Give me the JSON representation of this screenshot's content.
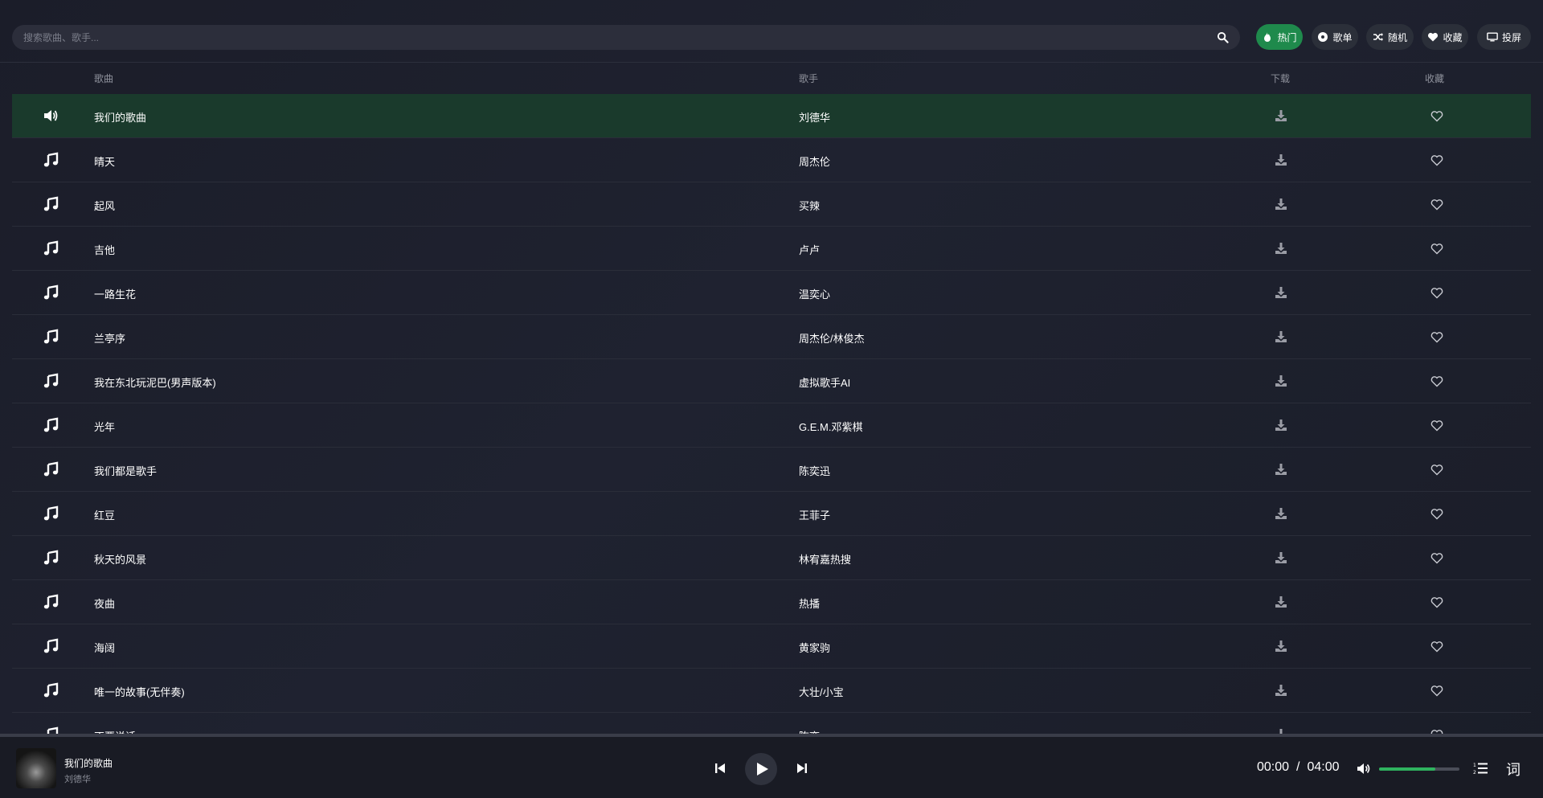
{
  "search": {
    "placeholder": "搜索歌曲、歌手..."
  },
  "nav": [
    {
      "label": "热门",
      "icon": "fire-icon",
      "active": true
    },
    {
      "label": "歌单",
      "icon": "disc-icon",
      "active": false
    },
    {
      "label": "随机",
      "icon": "shuffle-icon",
      "active": false
    },
    {
      "label": "收藏",
      "icon": "heart-icon",
      "active": false
    },
    {
      "label": "投屏",
      "icon": "tv-icon",
      "active": false
    }
  ],
  "table": {
    "headers": {
      "title": "歌曲",
      "artist": "歌手",
      "download": "下载",
      "favorite": "收藏"
    },
    "rows": [
      {
        "title": "我们的歌曲",
        "artist": "刘德华",
        "playing": true
      },
      {
        "title": "晴天",
        "artist": "周杰伦"
      },
      {
        "title": "起风",
        "artist": "买辣"
      },
      {
        "title": "吉他",
        "artist": "卢卢"
      },
      {
        "title": "一路生花",
        "artist": "温奕心"
      },
      {
        "title": "兰亭序",
        "artist": "周杰伦/林俊杰"
      },
      {
        "title": "我在东北玩泥巴(男声版本)",
        "artist": "虚拟歌手AI"
      },
      {
        "title": "光年",
        "artist": "G.E.M.邓紫棋"
      },
      {
        "title": "我们都是歌手",
        "artist": "陈奕迅"
      },
      {
        "title": "红豆",
        "artist": "王菲子"
      },
      {
        "title": "秋天的风景",
        "artist": "林宥嘉热搜"
      },
      {
        "title": "夜曲",
        "artist": "热播"
      },
      {
        "title": "海阔",
        "artist": "黄家驹"
      },
      {
        "title": "唯一的故事(无伴奏)",
        "artist": "大壮/小宝"
      },
      {
        "title": "不要说话",
        "artist": "陈奕"
      }
    ]
  },
  "player": {
    "title": "我们的歌曲",
    "artist": "刘德华",
    "current_time": "00:00",
    "separator": "/",
    "total_time": "04:00",
    "volume": 0.7,
    "lyrics_label": "词"
  },
  "colors": {
    "accent": "#1f8a4c",
    "progress": "#2fb35f",
    "active_row": "#1a3a2c"
  }
}
